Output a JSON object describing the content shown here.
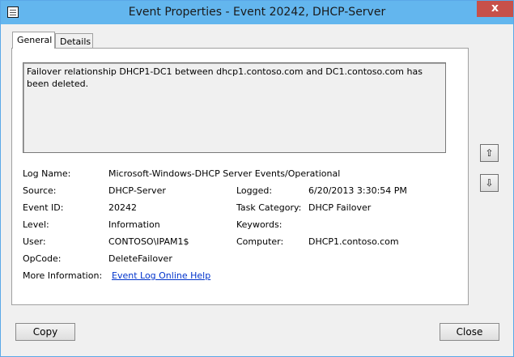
{
  "window": {
    "title": "Event Properties - Event 20242, DHCP-Server",
    "close_glyph": "x"
  },
  "tabs": [
    {
      "label": "General"
    },
    {
      "label": "Details"
    }
  ],
  "message": "Failover relationship DHCP1-DC1 between dhcp1.contoso.com and DC1.contoso.com has been deleted.",
  "fields": {
    "log_name": {
      "label": "Log Name:",
      "value": "Microsoft-Windows-DHCP Server Events/Operational"
    },
    "source": {
      "label": "Source:",
      "value": "DHCP-Server"
    },
    "logged": {
      "label": "Logged:",
      "value": "6/20/2013 3:30:54 PM"
    },
    "event_id": {
      "label": "Event ID:",
      "value": "20242"
    },
    "task_category": {
      "label": "Task Category:",
      "value": "DHCP Failover"
    },
    "level": {
      "label": "Level:",
      "value": "Information"
    },
    "keywords": {
      "label": "Keywords:",
      "value": ""
    },
    "user": {
      "label": "User:",
      "value": "CONTOSO\\IPAM1$"
    },
    "computer": {
      "label": "Computer:",
      "value": "DHCP1.contoso.com"
    },
    "opcode": {
      "label": "OpCode:",
      "value": "DeleteFailover"
    },
    "more_info": {
      "label": "More Information:",
      "link": "Event Log Online Help"
    }
  },
  "nav": {
    "up_glyph": "⇧",
    "down_glyph": "⇩"
  },
  "buttons": {
    "copy": "Copy",
    "close": "Close"
  }
}
